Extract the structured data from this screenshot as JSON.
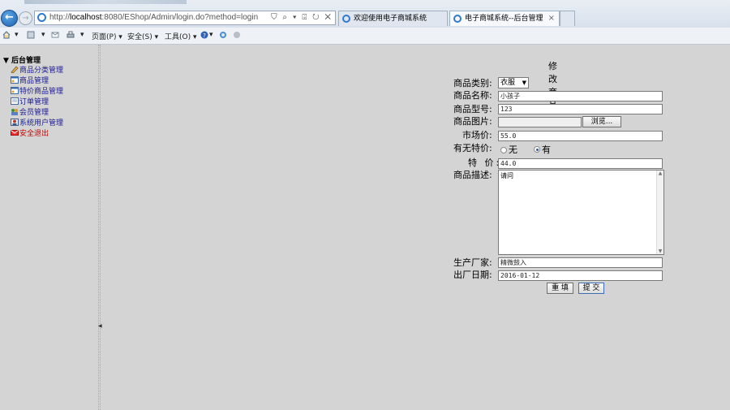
{
  "browser": {
    "address_url_prefix": "http://",
    "address_url_host": "localhost",
    "address_url_rest": ":8080/EShop/Admin/login.do?method=login",
    "address_tools": "⛉ ⌕ ▾ ⌹ ↻ ✕",
    "tabs": [
      {
        "label": "欢迎使用电子商城系统"
      },
      {
        "label": "电子商城系统--后台管理"
      }
    ],
    "close_tab": "×",
    "back_glyph": "←",
    "forward_glyph": "→"
  },
  "command_bar": {
    "home_caret": "▾",
    "feeds_caret": "▾",
    "print_caret": "▾",
    "page": "页面(P) ▾",
    "safety": "安全(S) ▾",
    "tools": "工具(O) ▾",
    "help_caret": "▾"
  },
  "sidebar": {
    "root_label": "▼ 后台管理",
    "items": [
      {
        "label": "商品分类管理",
        "icon": "pencil-icon"
      },
      {
        "label": "商品管理",
        "icon": "window-icon"
      },
      {
        "label": "特价商品管理",
        "icon": "window-icon"
      },
      {
        "label": "订单管理",
        "icon": "document-icon"
      },
      {
        "label": "会员管理",
        "icon": "users-icon"
      },
      {
        "label": "系统用户管理",
        "icon": "user-card-icon"
      },
      {
        "label": "安全退出",
        "icon": "exit-icon"
      }
    ]
  },
  "form": {
    "title": "修改商品",
    "category_label": "商品类别:",
    "category_value": "衣服",
    "name_label": "商品名称:",
    "name_value": "小孩子",
    "model_label": "商品型号:",
    "model_value": "123",
    "image_label": "商品图片:",
    "image_value": "",
    "browse_button": "浏览...",
    "market_price_label": "市场价:",
    "market_price_value": "55.0",
    "special_label": "有无特价:",
    "special_no": "无",
    "special_yes": "有",
    "special_selected": "有",
    "special_price_label": "特  价:",
    "special_price_value": "44.0",
    "description_label": "商品描述:",
    "description_value": "请问",
    "manufacturer_label": "生产厂家:",
    "manufacturer_value": "精微鼓入",
    "date_label": "出厂日期:",
    "date_value": "2016-01-12",
    "reset_button": "重 填",
    "submit_button": "提 交"
  },
  "colors": {
    "page_bg": "#d4d4d4",
    "link": "#1b1b8f",
    "visited_link": "#7a1a7a",
    "exit_red": "#cc0000"
  }
}
